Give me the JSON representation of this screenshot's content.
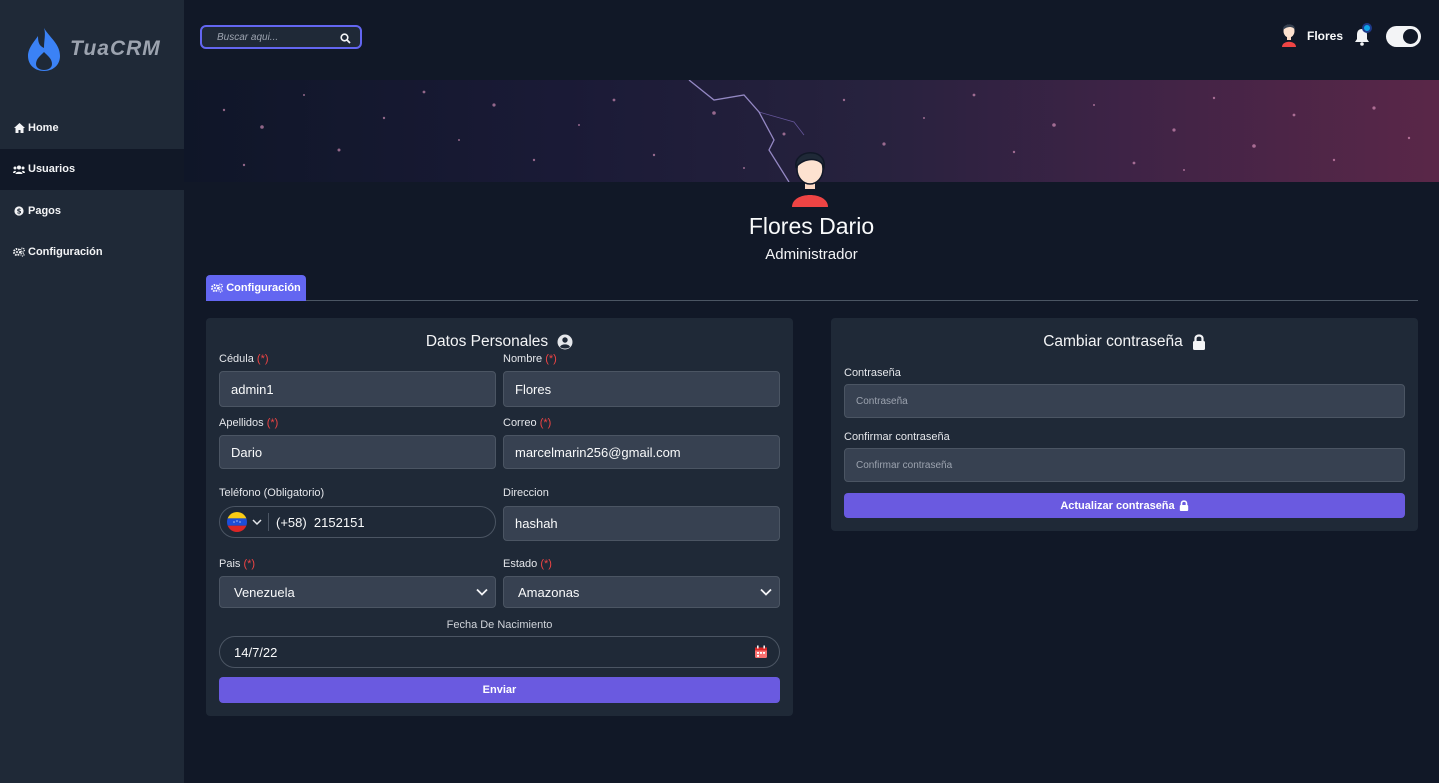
{
  "app": {
    "logo_text": "TuaCRM"
  },
  "sidebar": {
    "items": [
      {
        "label": "Home",
        "icon": "home-icon",
        "active": false
      },
      {
        "label": "Usuarios",
        "icon": "users-icon",
        "active": true
      },
      {
        "label": "Pagos",
        "icon": "dollar-circle-icon",
        "active": false
      },
      {
        "label": "Configuración",
        "icon": "gears-icon",
        "active": false
      }
    ]
  },
  "header": {
    "search_placeholder": "Buscar aqui...",
    "user_name": "Flores",
    "colors": {
      "accent": "#6366f1",
      "bell_dot": "#0ea5e9"
    }
  },
  "profile": {
    "name": "Flores Dario",
    "role": "Administrador"
  },
  "tabs": [
    {
      "label": "Configuración",
      "active": true
    }
  ],
  "personal": {
    "title": "Datos Personales",
    "required_mark": "(*)",
    "cedula": {
      "label": "Cédula",
      "value": "admin1"
    },
    "nombre": {
      "label": "Nombre",
      "value": "Flores"
    },
    "apellidos": {
      "label": "Apellidos",
      "value": "Dario"
    },
    "correo": {
      "label": "Correo",
      "value": "marcelmarin256@gmail.com"
    },
    "telefono": {
      "label": "Teléfono (Obligatorio)",
      "flag": "venezuela-flag-icon",
      "value": "(+58)  2152151"
    },
    "direccion": {
      "label": "Direccion",
      "value": "hashah"
    },
    "pais": {
      "label": "Pais",
      "value": "Venezuela"
    },
    "estado": {
      "label": "Estado",
      "value": "Amazonas"
    },
    "fecha": {
      "label": "Fecha De Nacimiento",
      "value": "14/7/22"
    },
    "submit_label": "Enviar"
  },
  "password": {
    "title": "Cambiar contraseña",
    "pass_label": "Contraseña",
    "pass_placeholder": "Contraseña",
    "confirm_label": "Confirmar contraseña",
    "confirm_placeholder": "Confirmar contraseña",
    "submit_label": "Actualizar contraseña"
  }
}
